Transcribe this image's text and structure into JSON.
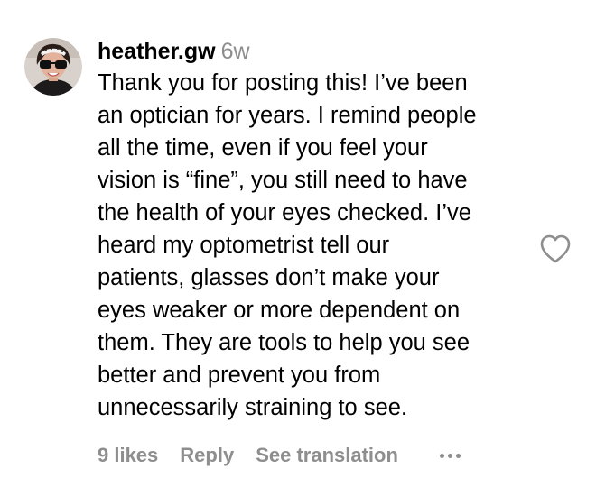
{
  "comment": {
    "username": "heather.gw",
    "time_ago": "6w",
    "text_lines": [
      "Thank you for posting this! I’ve been",
      "an optician for years. I remind people",
      "all the time, even if you feel your",
      "vision is “fine”, you still need to have",
      "the health of your eyes checked. I’ve",
      "heard my optometrist tell our",
      "patients, glasses don’t make your",
      "eyes weaker or more dependent on",
      "them. They are tools to help you see",
      "better and prevent you from",
      "unnecessarily straining to see."
    ],
    "likes_label": "9 likes",
    "reply_label": "Reply",
    "see_translation_label": "See translation",
    "avatar_icon": "user-avatar",
    "like_icon": "heart-outline-icon",
    "more_icon": "more-horizontal-icon"
  },
  "colors": {
    "text": "#000000",
    "secondary": "#8e8e8e"
  }
}
